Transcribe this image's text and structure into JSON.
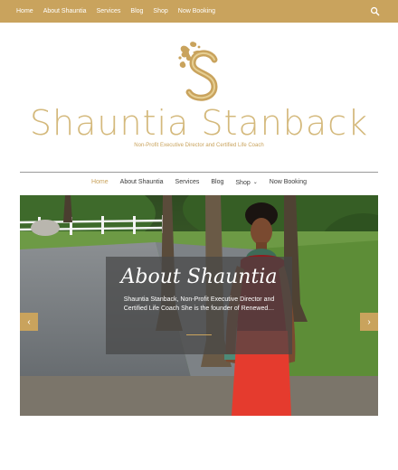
{
  "topbar": {
    "nav": [
      {
        "label": "Home"
      },
      {
        "label": "About Shauntia"
      },
      {
        "label": "Services"
      },
      {
        "label": "Blog"
      },
      {
        "label": "Shop"
      },
      {
        "label": "Now Booking"
      }
    ],
    "search_icon": "search-icon"
  },
  "logo": {
    "icon": "ornamental-s-monogram",
    "site_title": "Shauntia Stanback",
    "tagline": "Non-Profit Executive Director and Certified Life Coach"
  },
  "main_nav": {
    "items": [
      {
        "label": "Home",
        "active": true
      },
      {
        "label": "About Shauntia"
      },
      {
        "label": "Services"
      },
      {
        "label": "Blog"
      },
      {
        "label": "Shop",
        "has_dropdown": true
      },
      {
        "label": "Now Booking"
      }
    ]
  },
  "hero": {
    "title": "About Shauntia",
    "text": "Shauntia Stanback, Non-Profit Executive Director and Certified Life Coach She is the founder of Renewed…",
    "prev_icon": "chevron-left-icon",
    "next_icon": "chevron-right-icon"
  },
  "colors": {
    "accent": "#c9a35d",
    "title_gold": "#d4b97c"
  }
}
